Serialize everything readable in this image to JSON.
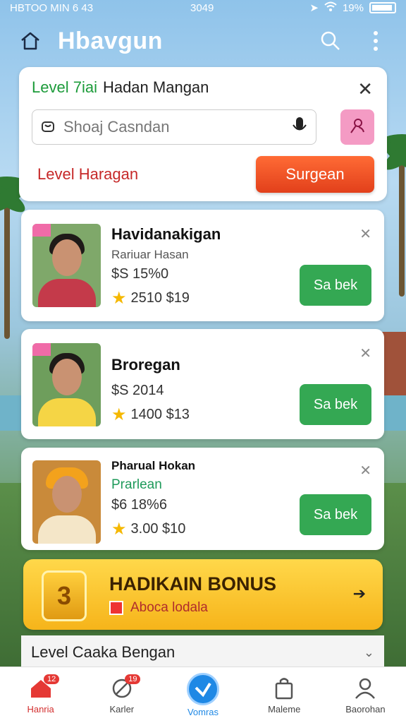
{
  "status_bar": {
    "left": "HBTOO MIN 6 43",
    "center": "3049",
    "battery_pct": "19%"
  },
  "appbar": {
    "title": "Hbavgun"
  },
  "search_card": {
    "head_level": "Level 7iai",
    "head_title": "Hadan Mangan",
    "placeholder": "Shoaj Casndan",
    "level_label": "Level Haragan",
    "submit_label": "Surgean"
  },
  "products": [
    {
      "name": "Havidanakigan",
      "sub": "Rariuar Hasan",
      "price": "$S 15%0",
      "rating": "2510 $19",
      "cta": "Sa bek",
      "shirt_color": "#c43a4a"
    },
    {
      "name": "Broregan",
      "sub": "",
      "price": "$S 2014",
      "rating": "1400 $13",
      "cta": "Sa bek",
      "shirt_color": "#f5d545"
    },
    {
      "name": "Pharual Hokan",
      "sub": "Prarlean",
      "price": "$6 18%6",
      "rating": "3.00 $10",
      "cta": "Sa bek",
      "shirt_color": "#f4e6c8"
    }
  ],
  "bonus": {
    "title": "HADIKAIN BONUS",
    "subtitle": "Aboca lodala",
    "badge_number": "3"
  },
  "section": {
    "label": "Level Caaka Bengan"
  },
  "bottom_nav": [
    {
      "label": "Hanria",
      "badge": "12",
      "icon": "home-icon"
    },
    {
      "label": "Karler",
      "badge": "19",
      "icon": "tools-icon"
    },
    {
      "label": "Vomras",
      "badge": "",
      "icon": "check-shield-icon"
    },
    {
      "label": "Maleme",
      "badge": "",
      "icon": "bag-icon"
    },
    {
      "label": "Baorohan",
      "badge": "",
      "icon": "user-icon"
    }
  ]
}
